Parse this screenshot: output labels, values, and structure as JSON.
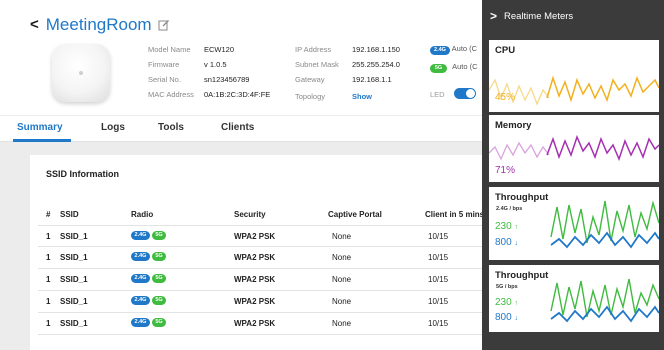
{
  "header": {
    "back_glyph": "<",
    "title": "MeetingRoom"
  },
  "device_info": {
    "col1": [
      {
        "key": "Model Name",
        "value": "ECW120"
      },
      {
        "key": "Firmware",
        "value": "v 1.0.5"
      },
      {
        "key": "Serial No.",
        "value": "sn123456789"
      },
      {
        "key": "MAC Address",
        "value": "0A:1B:2C:3D:4F:FE"
      }
    ],
    "col2": [
      {
        "key": "IP Address",
        "value": "192.168.1.150"
      },
      {
        "key": "Subnet Mask",
        "value": "255.255.254.0"
      },
      {
        "key": "Gateway",
        "value": "192.168.1.1"
      },
      {
        "key": "Topology",
        "value": "Show"
      }
    ],
    "radio_24_badge": "2.4G",
    "radio_24_text": "Auto (C",
    "radio_5_badge": "5G",
    "radio_5_text": "Auto (C",
    "led_label": "LED",
    "led_on": true
  },
  "tabs": [
    "Summary",
    "Logs",
    "Tools",
    "Clients"
  ],
  "ssid_card": {
    "title": "SSID Information",
    "columns": [
      "#",
      "SSID",
      "Radio",
      "Security",
      "Captive Portal",
      "Client in 5 mins"
    ],
    "rows": [
      {
        "num": "1",
        "ssid": "SSID_1",
        "radio": [
          "2.4G",
          "5G"
        ],
        "security": "WPA2 PSK",
        "portal": "None",
        "clients": "10/15"
      },
      {
        "num": "1",
        "ssid": "SSID_1",
        "radio": [
          "2.4G",
          "5G"
        ],
        "security": "WPA2 PSK",
        "portal": "None",
        "clients": "10/15"
      },
      {
        "num": "1",
        "ssid": "SSID_1",
        "radio": [
          "2.4G",
          "5G"
        ],
        "security": "WPA2 PSK",
        "portal": "None",
        "clients": "10/15"
      },
      {
        "num": "1",
        "ssid": "SSID_1",
        "radio": [
          "2.4G",
          "5G"
        ],
        "security": "WPA2 PSK",
        "portal": "None",
        "clients": "10/15"
      },
      {
        "num": "1",
        "ssid": "SSID_1",
        "radio": [
          "2.4G",
          "5G"
        ],
        "security": "WPA2 PSK",
        "portal": "None",
        "clients": "10/15"
      }
    ]
  },
  "realtime": {
    "chevron": ">",
    "title": "Realtime Meters",
    "cpu": {
      "label": "CPU",
      "value": "45%",
      "color": "#f2b01e",
      "faint_color": "#f7d98a"
    },
    "memory": {
      "label": "Memory",
      "value": "71%",
      "color": "#a62fb0",
      "faint_color": "#d9a2dd"
    },
    "throughput_24": {
      "label": "Throughput",
      "sub": "2.4G / bps",
      "up": "230",
      "down": "800",
      "up_color": "#3fbb3f",
      "down_color": "#1f78c8"
    },
    "throughput_5": {
      "label": "Throughput",
      "sub": "5G / bps",
      "up": "230",
      "down": "800",
      "up_color": "#3fbb3f",
      "down_color": "#1f78c8"
    }
  }
}
